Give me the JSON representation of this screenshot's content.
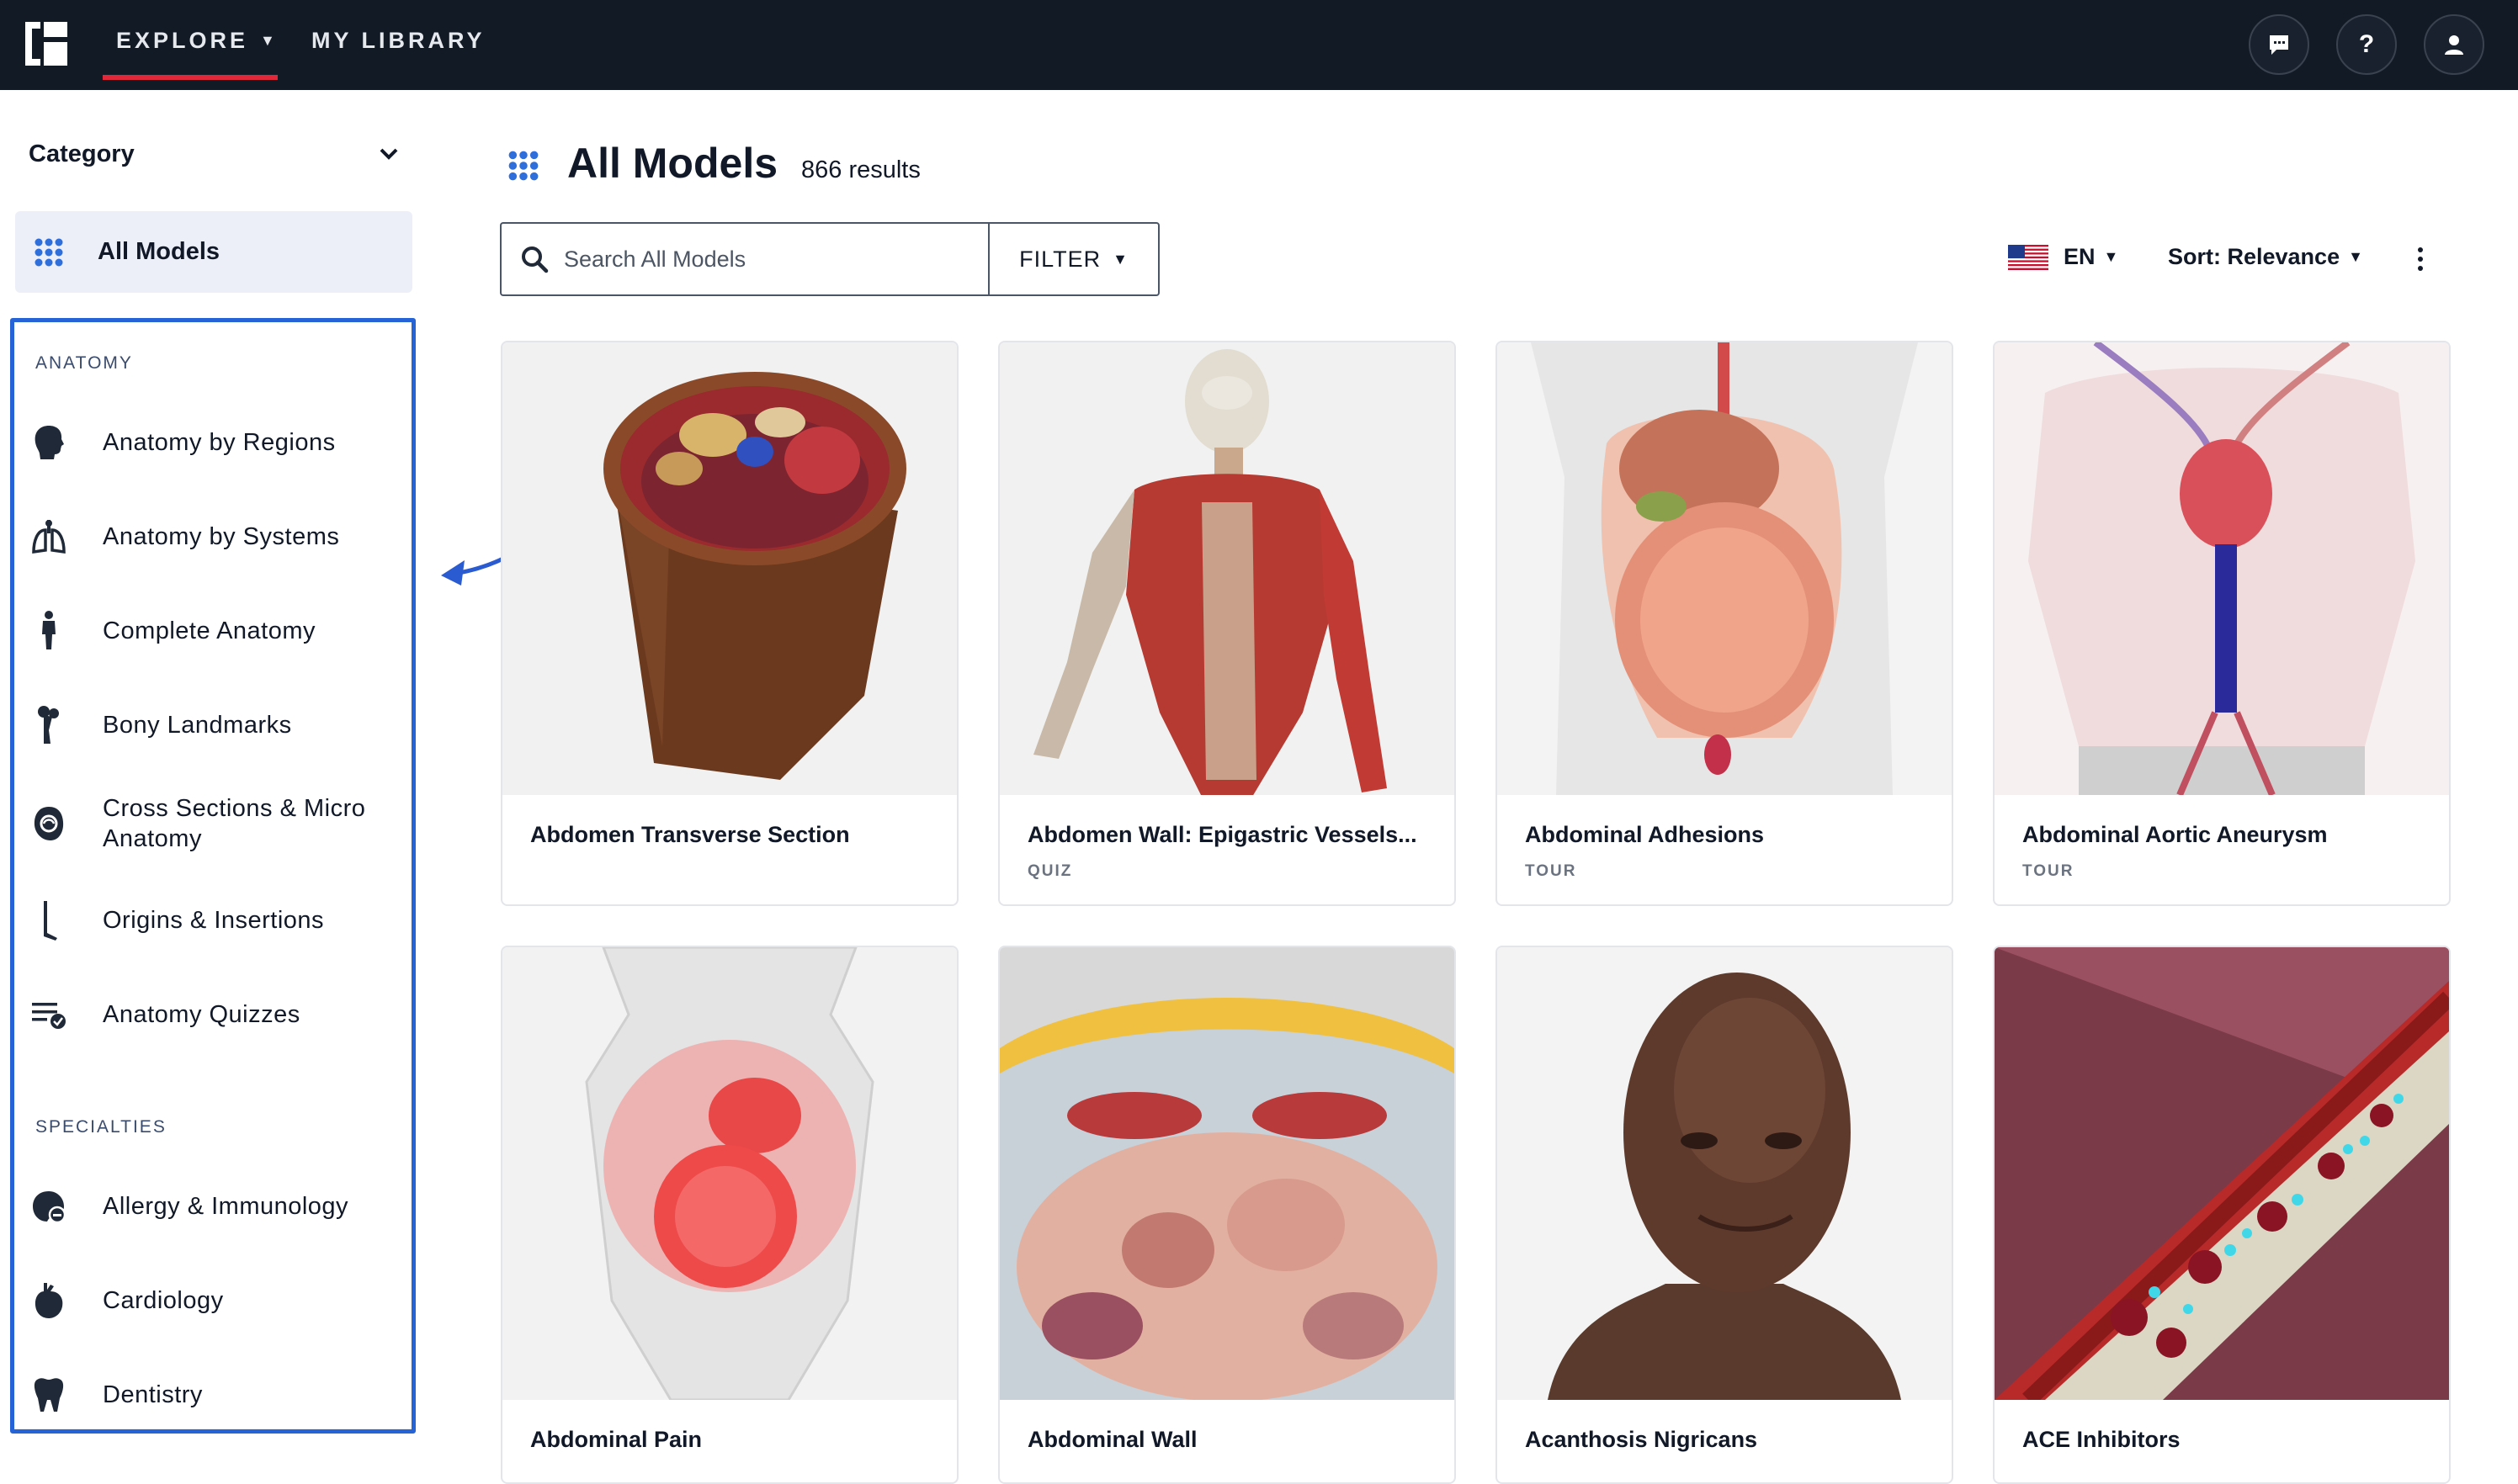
{
  "topbar": {
    "nav": [
      {
        "label": "EXPLORE",
        "active": true
      },
      {
        "label": "MY LIBRARY",
        "active": false
      }
    ],
    "icons": [
      "chat-icon",
      "help-icon",
      "user-icon"
    ],
    "help_glyph": "?"
  },
  "sidebar": {
    "category_label": "Category",
    "all_models_label": "All Models",
    "sections": [
      {
        "heading": "ANATOMY",
        "items": [
          {
            "label": "Anatomy by Regions",
            "icon": "head-icon"
          },
          {
            "label": "Anatomy by Systems",
            "icon": "lungs-icon"
          },
          {
            "label": "Complete Anatomy",
            "icon": "body-icon"
          },
          {
            "label": "Bony Landmarks",
            "icon": "bone-icon"
          },
          {
            "label": "Cross Sections & Micro Anatomy",
            "icon": "cross-section-icon"
          },
          {
            "label": "Origins & Insertions",
            "icon": "leg-icon"
          },
          {
            "label": "Anatomy Quizzes",
            "icon": "quiz-icon"
          }
        ]
      },
      {
        "heading": "SPECIALTIES",
        "items": [
          {
            "label": "Allergy & Immunology",
            "icon": "immunology-icon"
          },
          {
            "label": "Cardiology",
            "icon": "heart-icon"
          },
          {
            "label": "Dentistry",
            "icon": "tooth-icon"
          }
        ]
      }
    ]
  },
  "main": {
    "title": "All Models",
    "results": "866 results",
    "search_placeholder": "Search All Models",
    "filter_label": "FILTER",
    "language": "EN",
    "sort_label": "Sort: Relevance",
    "cards": [
      {
        "title": "Abdomen Transverse Section",
        "tag": ""
      },
      {
        "title": "Abdomen Wall: Epigastric Vessels...",
        "tag": "QUIZ"
      },
      {
        "title": "Abdominal Adhesions",
        "tag": "TOUR"
      },
      {
        "title": "Abdominal Aortic Aneurysm",
        "tag": "TOUR"
      },
      {
        "title": "Abdominal Pain",
        "tag": ""
      },
      {
        "title": "Abdominal Wall",
        "tag": ""
      },
      {
        "title": "Acanthosis Nigricans",
        "tag": ""
      },
      {
        "title": "ACE Inhibitors",
        "tag": ""
      }
    ]
  },
  "colors": {
    "topbar_bg": "#121a26",
    "nav_active_underline": "#e0283a",
    "highlight_border": "#2563d6",
    "selected_item_bg": "#eceff7",
    "accent_blue": "#2f6fdb"
  }
}
